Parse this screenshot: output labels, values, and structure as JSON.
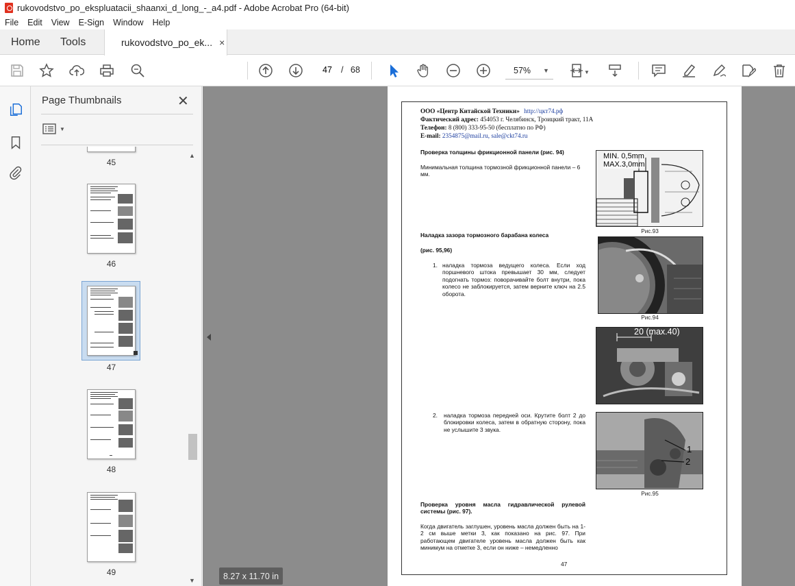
{
  "window": {
    "title": "rukovodstvo_po_ekspluatacii_shaanxi_d_long_-_a4.pdf - Adobe Acrobat Pro (64-bit)"
  },
  "menu": [
    "File",
    "Edit",
    "View",
    "E-Sign",
    "Window",
    "Help"
  ],
  "tabs": {
    "home": "Home",
    "tools": "Tools",
    "document": "rukovodstvo_po_ek...",
    "close": "×"
  },
  "toolbar": {
    "page_current": "47",
    "page_separator": "/",
    "page_total": "68",
    "zoom": "57%"
  },
  "thumbnails": {
    "title": "Page Thumbnails",
    "close": "✕",
    "pages": [
      "45",
      "46",
      "47",
      "48",
      "49"
    ],
    "selected": "47"
  },
  "page_size": "8.27 x 11.70 in",
  "document_page": {
    "header": {
      "company": "ООО «Центр Китайской Техники»",
      "company_url": "http://цкт74.рф",
      "address_label": "Фактический адрес:",
      "address": "454053 г. Челябинск, Троицкий тракт, 11А",
      "phone_label": "Телефон:",
      "phone": "8 (800) 333-95-50 (бесплатно по РФ)",
      "email_label": "E-mail:",
      "email": "2354875@mail.ru, sale@ckt74.ru"
    },
    "section1_title": "Проверка толщины фрикционной панели (рис. 94)",
    "section1_text": "Минимальная толщина тормозной фрикционной панели – 6 мм.",
    "fig93_label1": "MIN. 0,5mm",
    "fig93_label2": "MAX.3,0mm",
    "fig93_caption": "Рис.93",
    "section2_title": "Наладка зазора тормозного барабана колеса",
    "section2_ref": "(рис. 95,96)",
    "item1_num": "1.",
    "item1_text": "наладка тормоза ведущего колеса. Если ход поршневого штока превышает 30 мм, следует подогнать тормоз: поворачивайте болт внутри, пока колесо не заблокируется, затем верните ключ на 2.5 оборота.",
    "fig94_caption": "Рис.94",
    "fig_dim_label": "20 (max.40)",
    "item2_num": "2.",
    "item2_text": "наладка тормоза передней оси. Крутите болт 2 до блокировки колеса, затем в обратную сторону, пока не услышите 3 звука.",
    "fig95_label1": "1",
    "fig95_label2": "2",
    "fig95_caption": "Рис.95",
    "section3_title": "Проверка уровня масла гидравлической рулевой системы (рис. 97).",
    "section3_text": "Когда двигатель заглушен, уровень масла должен быть на 1-2 см выше метки 3, как показано на рис. 97. При работающем двигателе уровень масла должен быть как минимум на отметке 3, если он ниже – немедленно",
    "page_number": "47"
  }
}
